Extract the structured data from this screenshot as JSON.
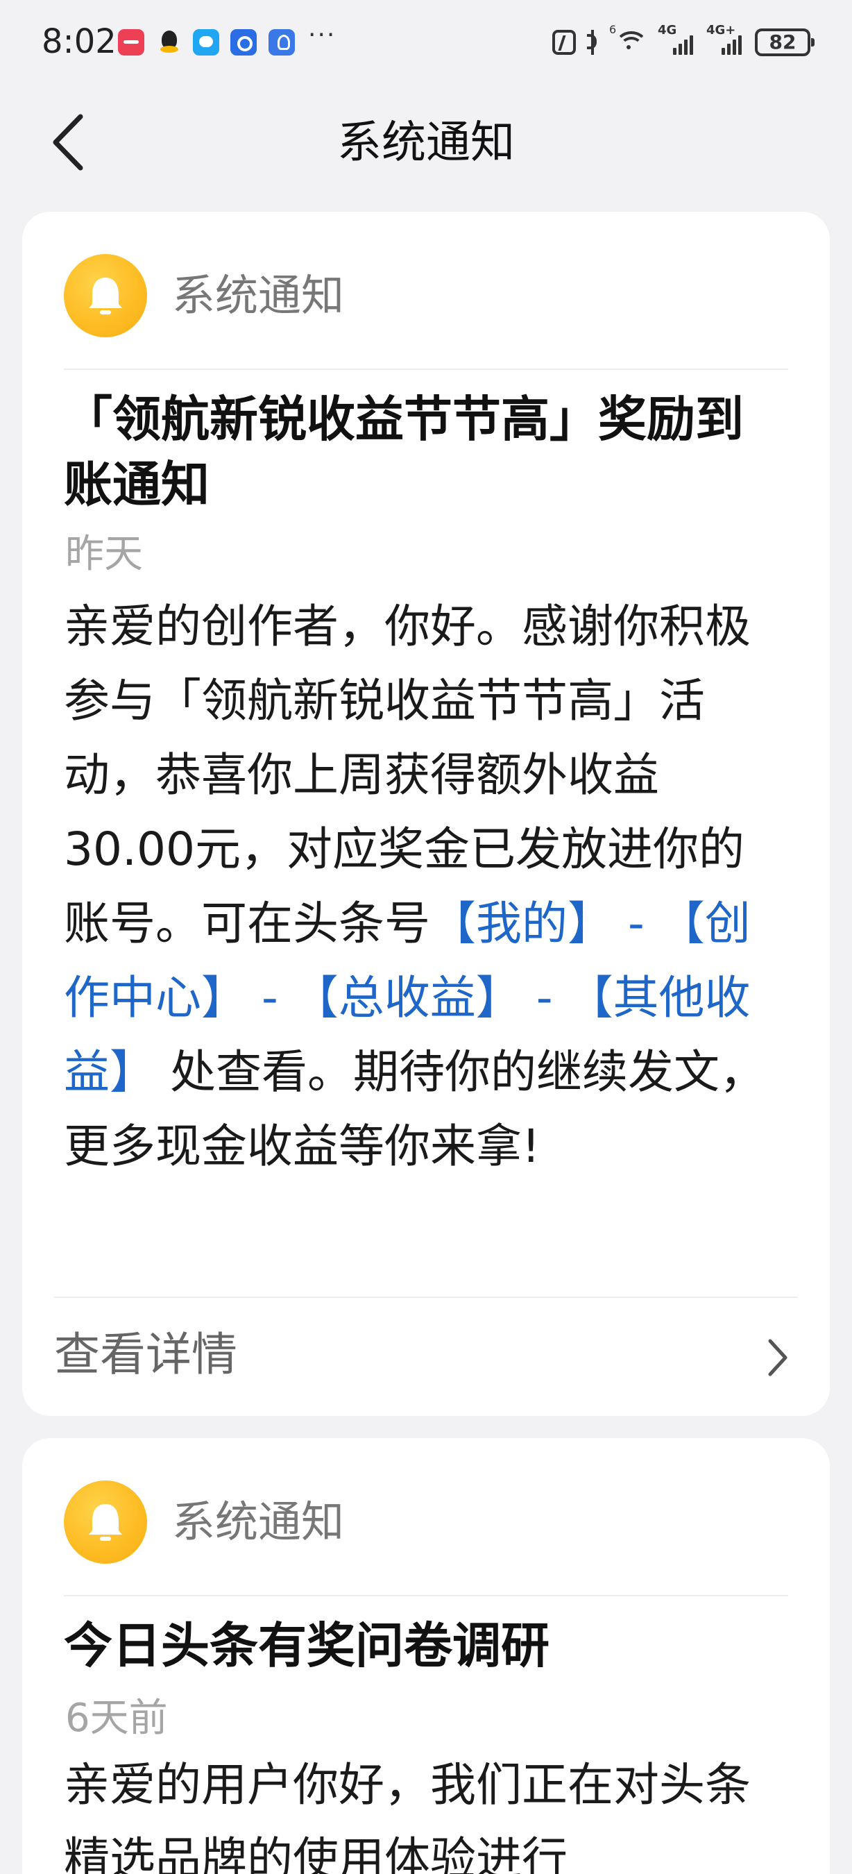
{
  "status_bar": {
    "time": "8:02",
    "more": "···",
    "wifi_label": "6",
    "signal1_label": "4G",
    "signal2_label": "4G+",
    "battery": "82"
  },
  "header": {
    "title": "系统通知"
  },
  "notifications": [
    {
      "sender": "系统通知",
      "title": "「领航新锐收益节节高」奖励到账通知",
      "time": "昨天",
      "body_pre": "亲爱的创作者，你好。感谢你积极参与「领航新锐收益节节高」活动，恭喜你上周获得额外收益30.00元，对应奖金已发放进你的账号。可在头条号",
      "link_mine": "【我的】",
      "sep1": " - ",
      "link_creator": "【创作中心】",
      "sep2": " - ",
      "link_total": "【总收益】",
      "sep3": " - ",
      "link_other": "【其他收益】",
      "body_post": " 处查看。期待你的继续发文，更多现金收益等你来拿!",
      "footer": "查看详情"
    },
    {
      "sender": "系统通知",
      "title": "今日头条有奖问卷调研",
      "time": "6天前",
      "body": "亲爱的用户你好，我们正在对头条精选品牌的使用体验进行"
    }
  ],
  "colors": {
    "background": "#f2f2f4",
    "card": "#ffffff",
    "link": "#1f66c9",
    "avatar": "#fdbb22",
    "muted": "#a5a5a5"
  },
  "icons": [
    "back-arrow-icon",
    "bell-icon",
    "chevron-right-icon",
    "nfc-icon",
    "bluetooth-icon",
    "wifi-icon",
    "signal-icon",
    "battery-icon"
  ]
}
